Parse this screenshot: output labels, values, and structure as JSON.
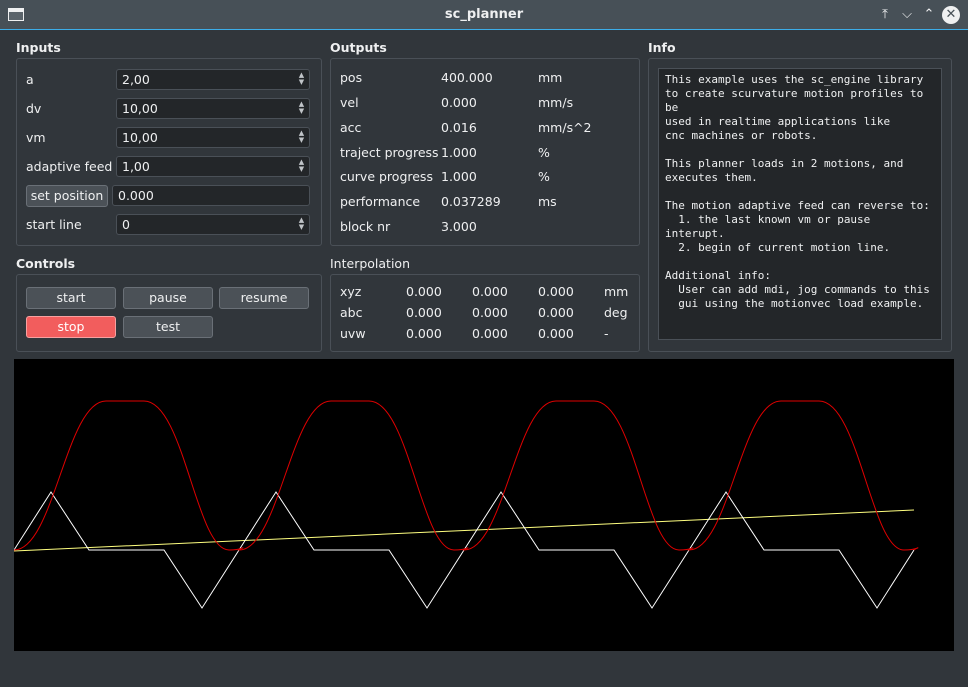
{
  "window": {
    "title": "sc_planner"
  },
  "inputs": {
    "title": "Inputs",
    "a": {
      "label": "a",
      "value": "2,00"
    },
    "dv": {
      "label": "dv",
      "value": "10,00"
    },
    "vm": {
      "label": "vm",
      "value": "10,00"
    },
    "adaptive_feed": {
      "label": "adaptive feed",
      "value": "1,00"
    },
    "set_position": {
      "label": "set position",
      "value": "0.000"
    },
    "start_line": {
      "label": "start line",
      "value": "0"
    }
  },
  "controls": {
    "title": "Controls",
    "start": "start",
    "pause": "pause",
    "resume": "resume",
    "stop": "stop",
    "test": "test"
  },
  "outputs": {
    "title": "Outputs",
    "rows": [
      {
        "label": "pos",
        "value": "400.000",
        "unit": "mm"
      },
      {
        "label": "vel",
        "value": "0.000",
        "unit": "mm/s"
      },
      {
        "label": "acc",
        "value": "0.016",
        "unit": "mm/s^2"
      },
      {
        "label": "traject progress",
        "value": "1.000",
        "unit": "%"
      },
      {
        "label": "curve progress",
        "value": "1.000",
        "unit": "%"
      },
      {
        "label": "performance",
        "value": "0.037289",
        "unit": "ms"
      },
      {
        "label": "block nr",
        "value": "3.000",
        "unit": ""
      }
    ]
  },
  "interpolation": {
    "title": "Interpolation",
    "rows": [
      {
        "label": "xyz",
        "v1": "0.000",
        "v2": "0.000",
        "v3": "0.000",
        "unit": "mm"
      },
      {
        "label": "abc",
        "v1": "0.000",
        "v2": "0.000",
        "v3": "0.000",
        "unit": "deg"
      },
      {
        "label": "uvw",
        "v1": "0.000",
        "v2": "0.000",
        "v3": "0.000",
        "unit": "-"
      }
    ]
  },
  "info": {
    "title": "Info",
    "text": "This example uses the sc_engine library\nto create scurvature motion profiles to\nbe\nused in realtime applications like\ncnc machines or robots.\n\nThis planner loads in 2 motions, and\nexecutes them.\n\nThe motion adaptive feed can reverse to:\n  1. the last known vm or pause interupt.\n  2. begin of current motion line.\n\nAdditional info:\n  User can add mdi, jog commands to this\n  gui using the motionvec load example."
  },
  "plot": {
    "colors": {
      "background": "#000000",
      "velocity": "#e00000",
      "acceleration": "#ffffff",
      "position": "#ffff80"
    }
  }
}
